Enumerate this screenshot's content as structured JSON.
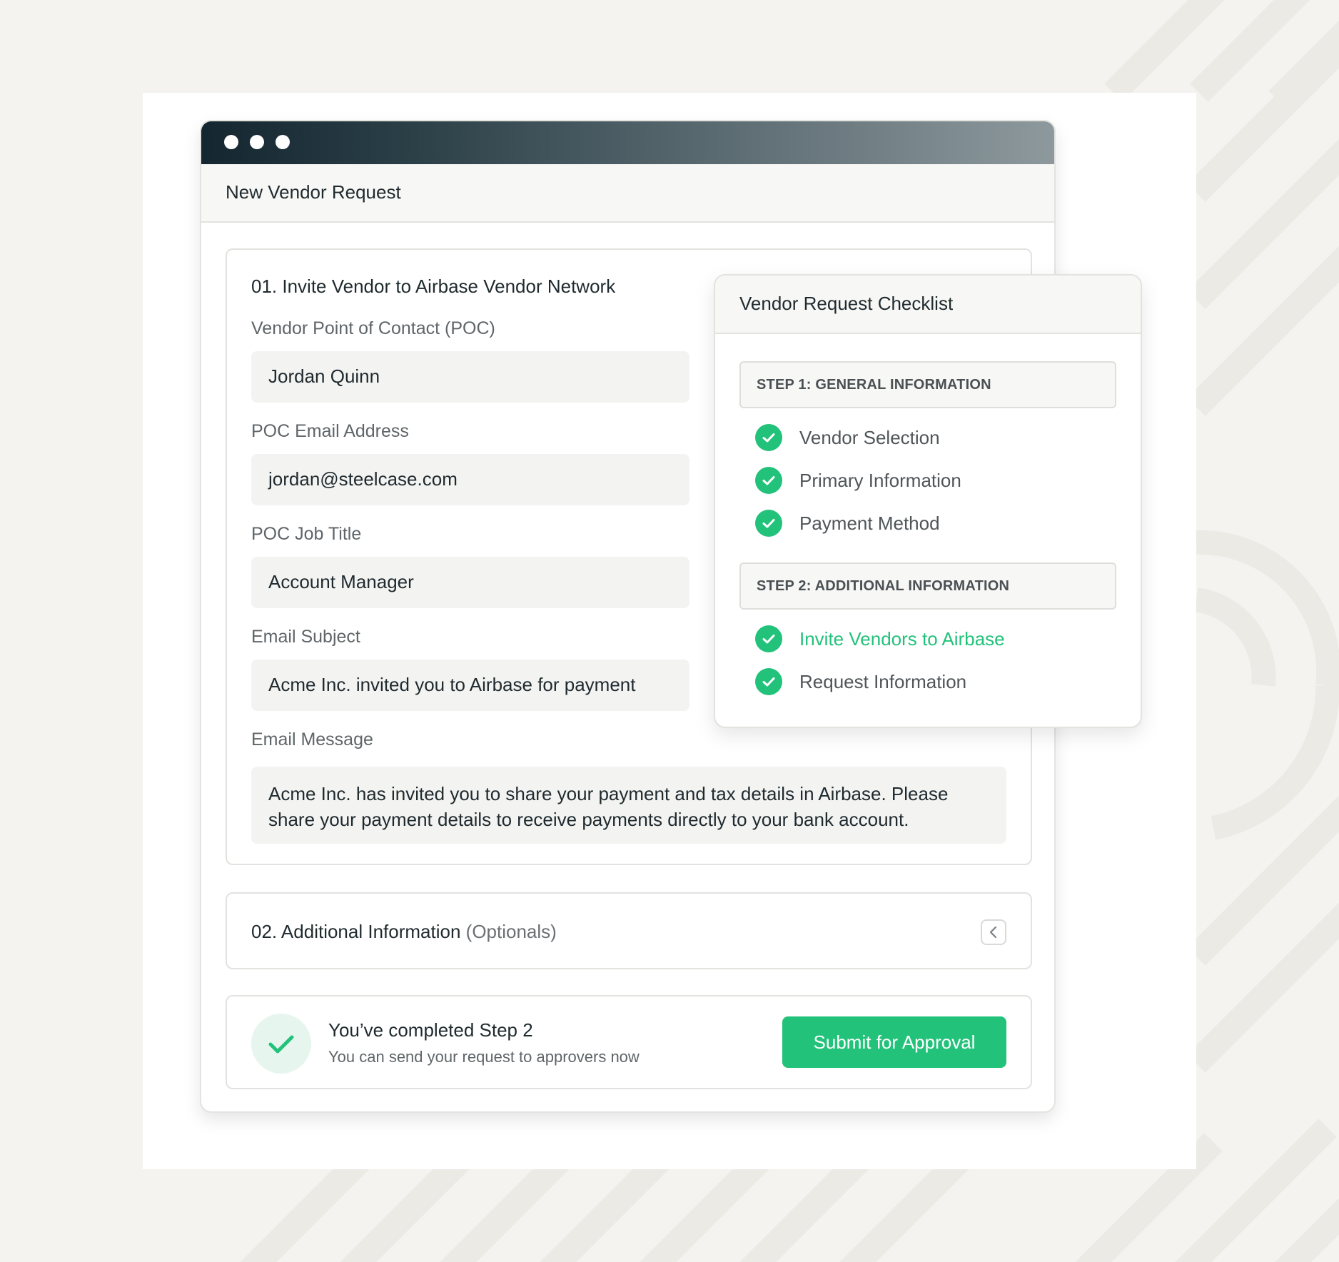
{
  "window": {
    "header_title": "New Vendor Request"
  },
  "section1": {
    "title": "01. Invite Vendor to Airbase Vendor Network",
    "fields": [
      {
        "label": "Vendor Point of Contact (POC)",
        "value": "Jordan Quinn"
      },
      {
        "label": "POC Email Address",
        "value": "jordan@steelcase.com"
      },
      {
        "label": "POC Job Title",
        "value": "Account Manager"
      },
      {
        "label": "Email Subject",
        "value": "Acme Inc. invited you to Airbase for payment"
      }
    ],
    "message_label": "Email Message",
    "message_line1": "Acme Inc. has invited you to share your payment and tax details in Airbase. Please",
    "message_line2": "share your payment details to receive payments directly to your bank account."
  },
  "section2": {
    "title": "02. Additional Information",
    "optional": "(Optionals)",
    "collapse_icon": "chevron-left-icon"
  },
  "completion": {
    "title": "You’ve completed Step 2",
    "subtitle": "You can send your request to approvers now",
    "button": "Submit for Approval",
    "icon": "check-icon"
  },
  "checklist": {
    "title": "Vendor Request Checklist",
    "step1": {
      "label": "STEP 1: GENERAL INFORMATION",
      "items": [
        "Vendor Selection",
        "Primary Information",
        "Payment Method"
      ]
    },
    "step2": {
      "label": "STEP 2: ADDITIONAL INFORMATION",
      "items": [
        "Invite Vendors to Airbase",
        "Request Information"
      ],
      "active_item": "Invite Vendors to Airbase"
    }
  },
  "colors": {
    "accent_green": "#23c27b",
    "titlebar_dark": "#142630",
    "page_background": "#f4f3ef"
  }
}
